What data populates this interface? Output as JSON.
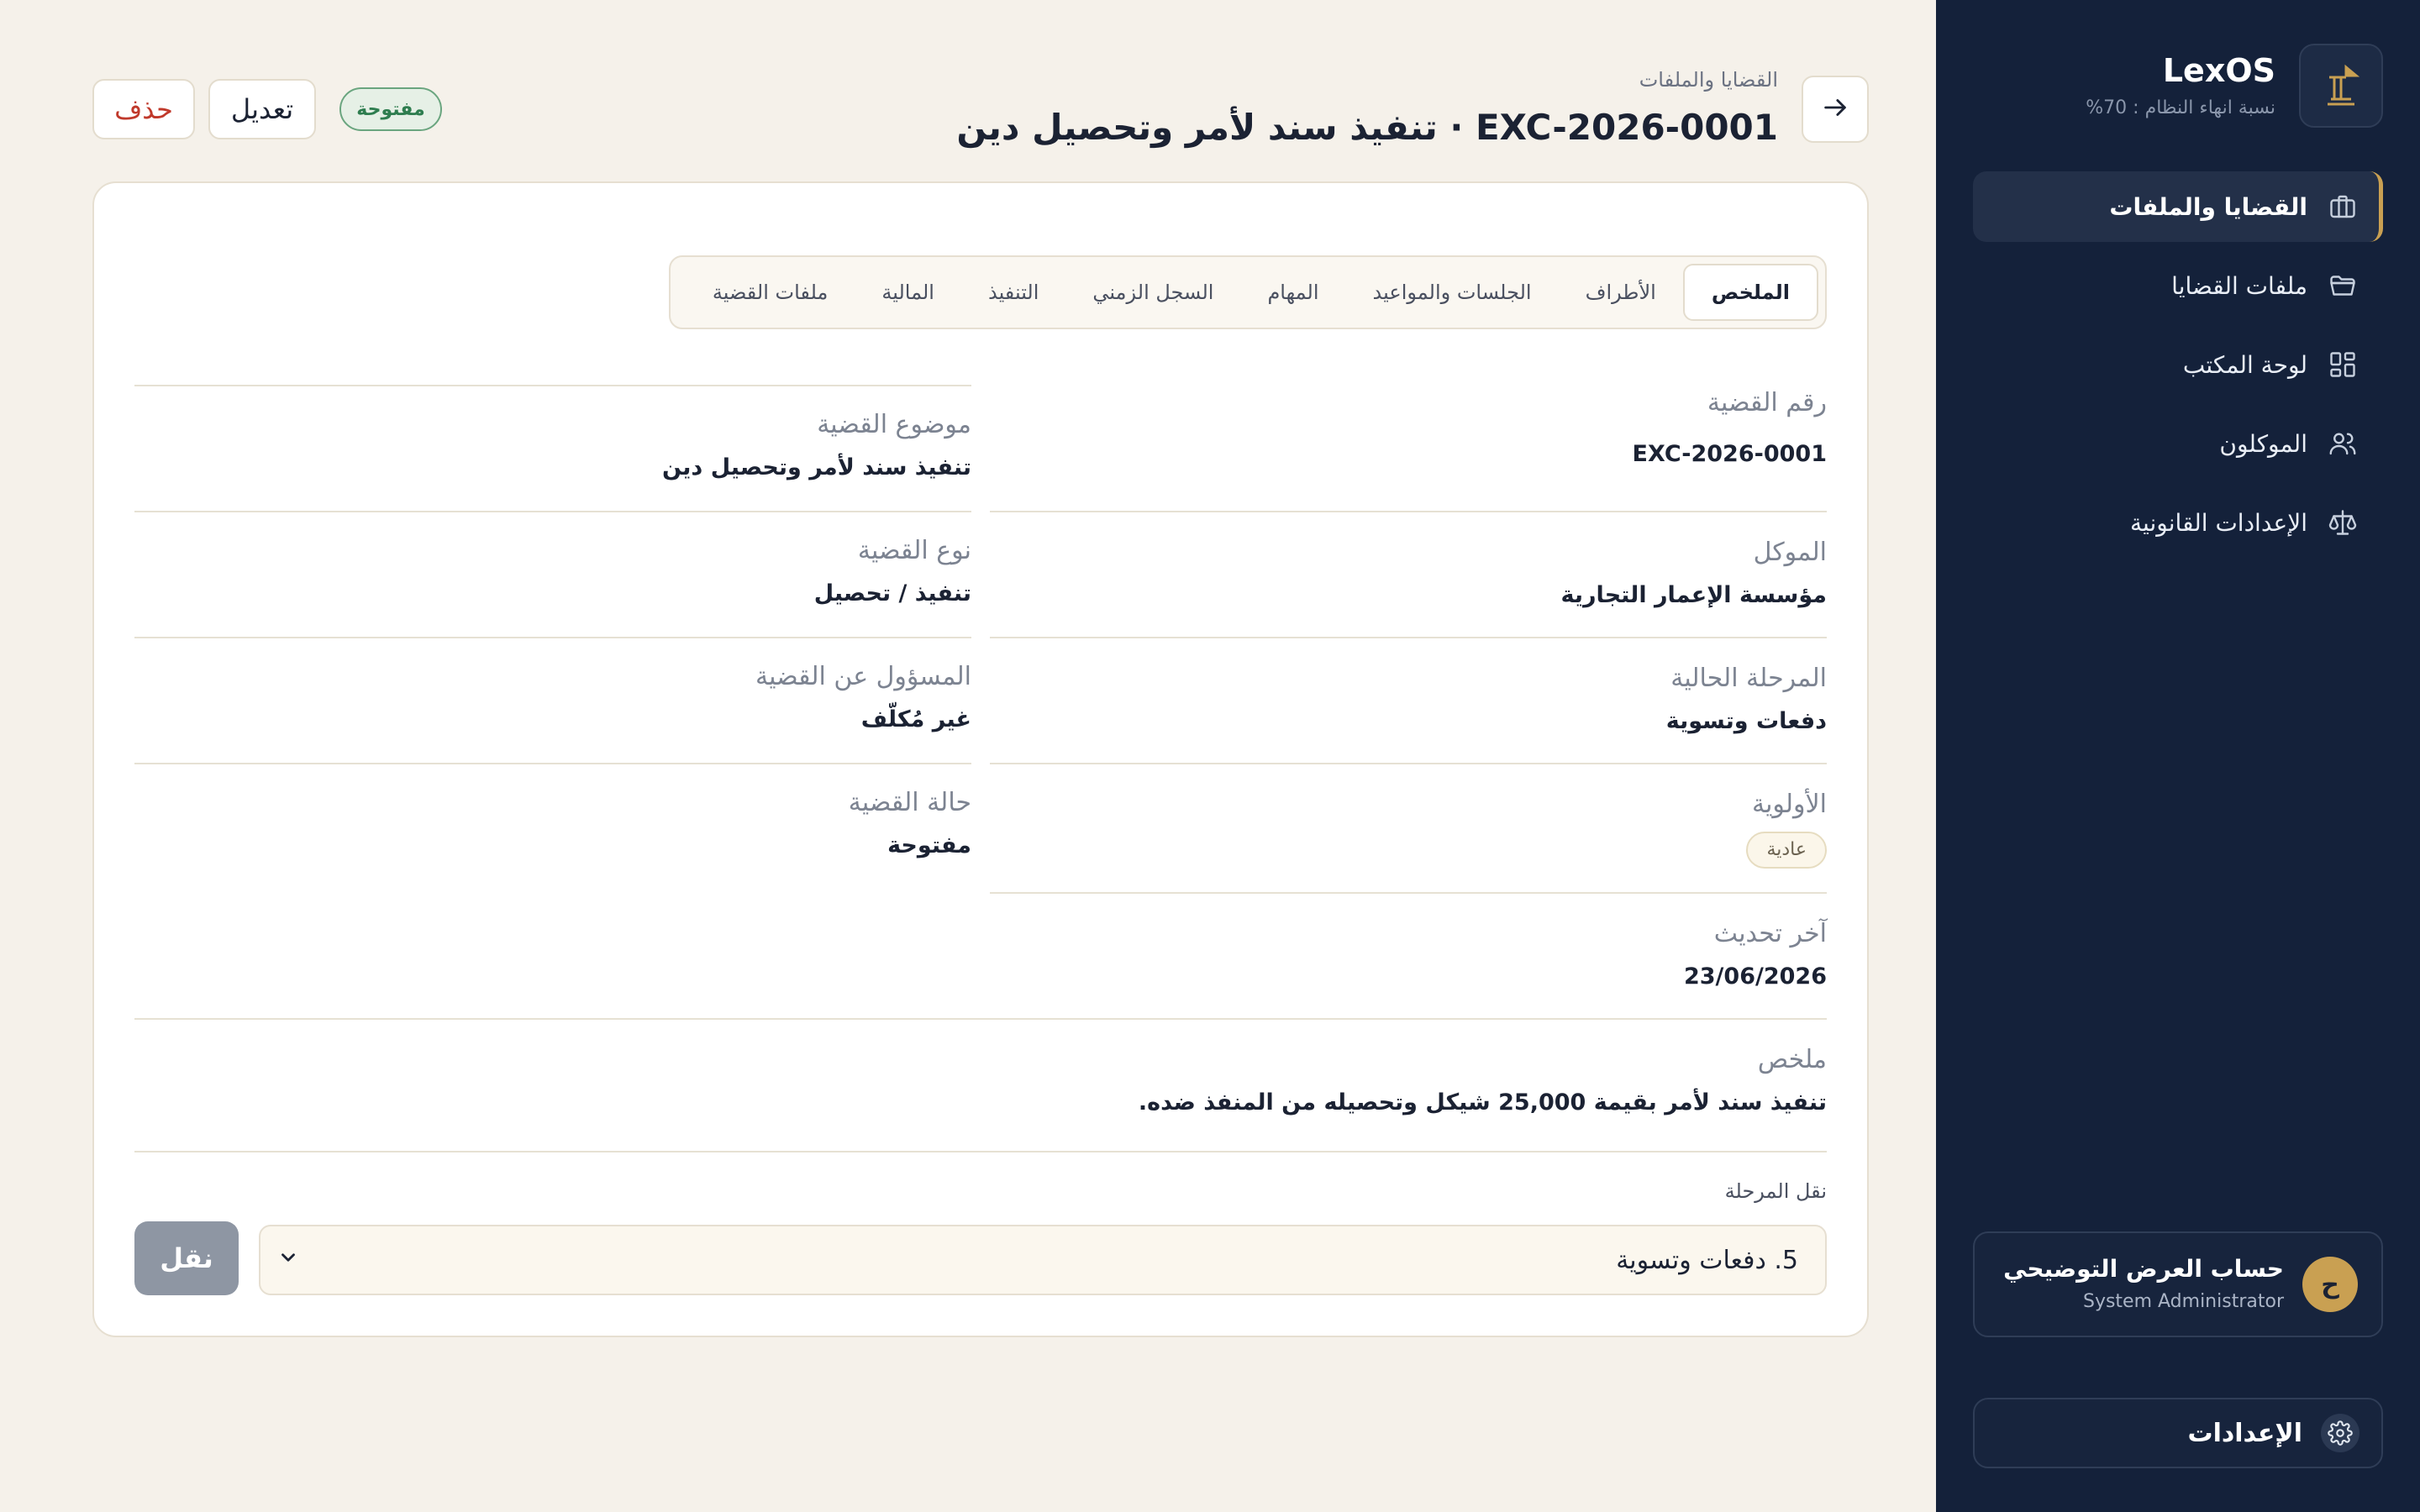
{
  "sidebar": {
    "brand_name": "LexOS",
    "brand_sub": "نسبة انهاء النظام : 70%",
    "items": [
      {
        "label": "القضايا والملفات",
        "icon": "briefcase-icon",
        "active": true
      },
      {
        "label": "ملفات القضايا",
        "icon": "folder-icon",
        "active": false
      },
      {
        "label": "لوحة المكتب",
        "icon": "dashboard-icon",
        "active": false
      },
      {
        "label": "الموكلون",
        "icon": "users-icon",
        "active": false
      },
      {
        "label": "الإعدادات القانونية",
        "icon": "scales-icon",
        "active": false
      }
    ],
    "user": {
      "initial": "ح",
      "name": "حساب العرض التوضيحي",
      "role": "System Administrator"
    },
    "settings_label": "الإعدادات"
  },
  "header": {
    "breadcrumb": "القضايا والملفات",
    "title": "EXC-2026-0001 · تنفيذ سند لأمر وتحصيل دين",
    "status": "مفتوحة",
    "edit_label": "تعديل",
    "delete_label": "حذف"
  },
  "tabs": [
    {
      "label": "الملخص",
      "active": true
    },
    {
      "label": "الأطراف",
      "active": false
    },
    {
      "label": "الجلسات والمواعيد",
      "active": false
    },
    {
      "label": "المهام",
      "active": false
    },
    {
      "label": "السجل الزمني",
      "active": false
    },
    {
      "label": "التنفيذ",
      "active": false
    },
    {
      "label": "المالية",
      "active": false
    },
    {
      "label": "ملفات القضية",
      "active": false
    }
  ],
  "summary": {
    "case_number": {
      "label": "رقم القضية",
      "value": "EXC-2026-0001"
    },
    "client": {
      "label": "الموكل",
      "value": "مؤسسة الإعمار التجارية"
    },
    "stage": {
      "label": "المرحلة الحالية",
      "value": "دفعات وتسوية"
    },
    "priority": {
      "label": "الأولوية",
      "value": "عادية"
    },
    "updated": {
      "label": "آخر تحديث",
      "value": "23/06/2026"
    },
    "subject": {
      "label": "موضوع القضية",
      "value": "تنفيذ سند لأمر وتحصيل دين"
    },
    "type": {
      "label": "نوع القضية",
      "value": "تنفيذ / تحصيل"
    },
    "owner": {
      "label": "المسؤول عن القضية",
      "value": "غير مُكلّف"
    },
    "status": {
      "label": "حالة القضية",
      "value": "مفتوحة"
    },
    "notes": {
      "label": "ملخص",
      "value": "تنفيذ سند لأمر بقيمة 25,000 شيكل وتحصيله من المنفذ ضده."
    }
  },
  "stage_move": {
    "label": "نقل المرحلة",
    "selected": "5. دفعات وتسوية",
    "button": "نقل"
  },
  "colors": {
    "sidebar_bg": "#14213a",
    "accent_gold": "#c9a052",
    "page_bg": "#f5f1ea",
    "danger": "#c0392b",
    "success": "#2e7d4f"
  }
}
